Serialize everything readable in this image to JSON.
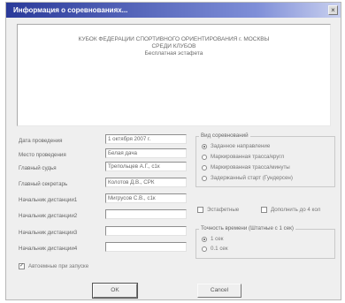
{
  "window": {
    "title": "Информация о соревнованиях...",
    "close_glyph": "×"
  },
  "header": {
    "line1": "КУБОК ФЕДЕРАЦИИ СПОРТИВНОГО ОРИЕНТИРОВАНИЯ г. МОСКВЫ",
    "line2": "СРЕДИ КЛУБОВ",
    "line3": "Бесплатная эстафета"
  },
  "fields": {
    "date": {
      "label": "Дата проведения",
      "value": "1 октября 2007 г."
    },
    "place": {
      "label": "Место проведения",
      "value": "Белая дача"
    },
    "chief_judge": {
      "label": "Главный судья",
      "value": "Трепольцев А.Г., с1к"
    },
    "chief_secretary": {
      "label": "Главный секретарь",
      "value": "Колотов Д.В., СРК"
    },
    "dist1": {
      "label": "Начальник дистанции1",
      "value": "Мигрусов С.В., с1к"
    },
    "dist2": {
      "label": "Начальник дистанции2",
      "value": ""
    },
    "dist3": {
      "label": "Начальник дистанции3",
      "value": ""
    },
    "dist4": {
      "label": "Начальник дистанции4",
      "value": ""
    }
  },
  "competition_type": {
    "title": "Вид соревнований",
    "options": [
      {
        "label": "Заданное направление",
        "selected": true
      },
      {
        "label": "Маркированная трасса/кругл",
        "selected": false
      },
      {
        "label": "Маркированная трасса/минуты",
        "selected": false
      },
      {
        "label": "Задержанный старт (Гундерсен)",
        "selected": false
      }
    ]
  },
  "relay_check": {
    "label": "Эстафетные",
    "checked": false
  },
  "extra_check": {
    "label": "Дополнить до 4 кол",
    "checked": false
  },
  "precision": {
    "title": "Точность времени (Штатные с 1 сек)",
    "options": [
      {
        "label": "1 сек",
        "selected": true
      },
      {
        "label": "0.1 сек",
        "selected": false
      }
    ]
  },
  "autostart": {
    "label": "Автоемные при запуске",
    "checked": true,
    "check_glyph": "✓"
  },
  "buttons": {
    "ok": "OK",
    "cancel": "Cancel"
  }
}
